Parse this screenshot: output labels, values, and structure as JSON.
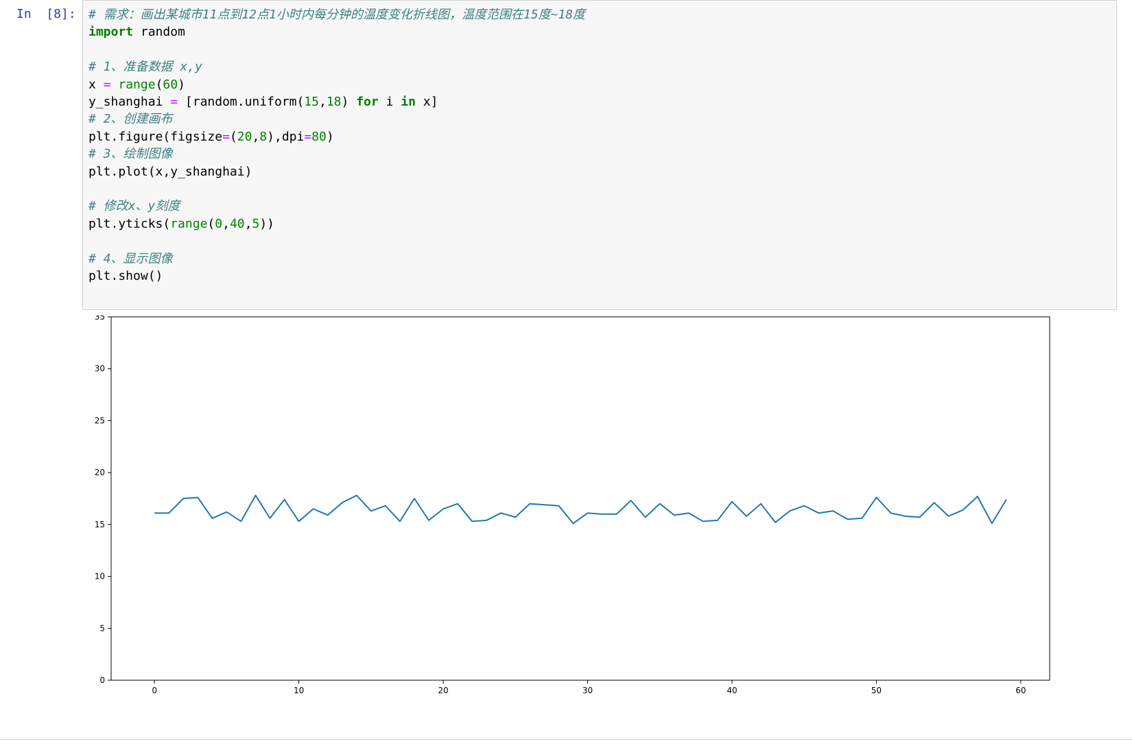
{
  "cell": {
    "prompt": "In  [8]:",
    "code_lines": [
      "# 需求：画出某城市11点到12点1小时内每分钟的温度变化折线图，温度范围在15度~18度",
      "import random",
      "",
      "# 1、准备数据 x,y",
      "x = range(60)",
      "y_shanghai = [random.uniform(15,18) for i in x]",
      "# 2、创建画布",
      "plt.figure(figsize=(20,8),dpi=80)",
      "# 3、绘制图像",
      "plt.plot(x,y_shanghai)",
      "",
      "# 修改x、y刻度",
      "plt.yticks(range(0,40,5))",
      "",
      "# 4、显示图像",
      "plt.show()"
    ]
  },
  "chart_data": {
    "type": "line",
    "title": "",
    "xlabel": "",
    "ylabel": "",
    "xlim": [
      -3,
      62
    ],
    "ylim": [
      0,
      35
    ],
    "xticks": [
      0,
      10,
      20,
      30,
      40,
      50,
      60
    ],
    "yticks": [
      0,
      5,
      10,
      15,
      20,
      25,
      30,
      35
    ],
    "grid": false,
    "line_color": "#1f77b4",
    "series": [
      {
        "x": [
          0,
          1,
          2,
          3,
          4,
          5,
          6,
          7,
          8,
          9,
          10,
          11,
          12,
          13,
          14,
          15,
          16,
          17,
          18,
          19,
          20,
          21,
          22,
          23,
          24,
          25,
          26,
          27,
          28,
          29,
          30,
          31,
          32,
          33,
          34,
          35,
          36,
          37,
          38,
          39,
          40,
          41,
          42,
          43,
          44,
          45,
          46,
          47,
          48,
          49,
          50,
          51,
          52,
          53,
          54,
          55,
          56,
          57,
          58,
          59
        ],
        "y": [
          16.1,
          16.1,
          17.5,
          17.6,
          15.6,
          16.2,
          15.3,
          17.8,
          15.6,
          17.4,
          15.3,
          16.5,
          15.9,
          17.1,
          17.8,
          16.3,
          16.8,
          15.3,
          17.5,
          15.4,
          16.5,
          17.0,
          15.3,
          15.4,
          16.1,
          15.7,
          17.0,
          16.9,
          16.8,
          15.1,
          16.1,
          16.0,
          16.0,
          17.3,
          15.7,
          17.0,
          15.9,
          16.1,
          15.3,
          15.4,
          17.2,
          15.8,
          17.0,
          15.2,
          16.3,
          16.8,
          16.1,
          16.3,
          15.5,
          15.6,
          17.6,
          16.1,
          15.8,
          15.7,
          17.1,
          15.8,
          16.4,
          17.7,
          15.1,
          17.4
        ]
      }
    ]
  }
}
